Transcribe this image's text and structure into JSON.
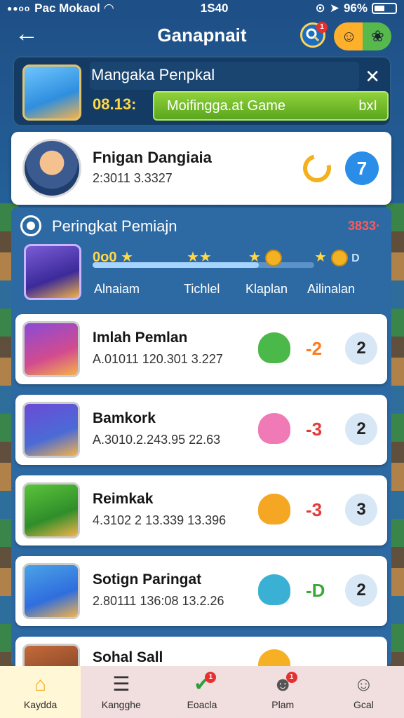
{
  "status_bar": {
    "carrier": "Pac Mokaol",
    "time": "1S40",
    "battery": "96%"
  },
  "header": {
    "title": "Ganapnait",
    "search_badge": "1"
  },
  "promo": {
    "title": "Mangaka Penpkal",
    "code": "08.13:",
    "button_label": "Moifingga.at Game",
    "button_tag": "bxI"
  },
  "profile": {
    "name": "Fnigan Dangiaia",
    "meta": "2:3011 3.3327",
    "rank": "7"
  },
  "ranking": {
    "title": "Peringkat Pemiajn",
    "count": "3833·",
    "level_value": "0o0",
    "milestones": [
      {
        "label": "Alnaiam"
      },
      {
        "label": "Tichlel"
      },
      {
        "label": "Klaplan"
      },
      {
        "label": "Ailinalan"
      }
    ],
    "tail": "D",
    "progress": 0.75
  },
  "players": [
    {
      "name": "Imlah Pemlan",
      "meta": "A.01011 120.301 3.227",
      "delta": "-2",
      "delta_color": "#ff7a1a",
      "rank": "2",
      "pet_color": "#4bb84a"
    },
    {
      "name": "Bamkork",
      "meta": "A.3010.2.243.95 22.63",
      "delta": "-3",
      "delta_color": "#e33a3a",
      "rank": "2",
      "pet_color": "#f07ab6"
    },
    {
      "name": "Reimkak",
      "meta": "4.3102 2 13.339 13.396",
      "delta": "-3",
      "delta_color": "#e33a3a",
      "rank": "3",
      "pet_color": "#f5a623"
    },
    {
      "name": "Sotign Paringat",
      "meta": "2.80111 136:08 13.2.26",
      "delta": "-D",
      "delta_color": "#3aa83a",
      "rank": "2",
      "pet_color": "#3ab1d4"
    },
    {
      "name": "Sohal Sall",
      "meta": "",
      "delta": "",
      "delta_color": "#e33a3a",
      "rank": "",
      "pet_color": "#f5b024"
    }
  ],
  "nav": {
    "items": [
      {
        "label": "Kaydda",
        "icon": "home-icon",
        "glyph": "⌂"
      },
      {
        "label": "Kangghe",
        "icon": "list-icon",
        "glyph": "☰"
      },
      {
        "label": "Eoacla",
        "icon": "check-icon",
        "glyph": "✔",
        "badge": "1"
      },
      {
        "label": "Plam",
        "icon": "mascot-icon",
        "glyph": "☻",
        "badge": "1"
      },
      {
        "label": "Gcal",
        "icon": "profile-icon",
        "glyph": "☺"
      }
    ]
  }
}
